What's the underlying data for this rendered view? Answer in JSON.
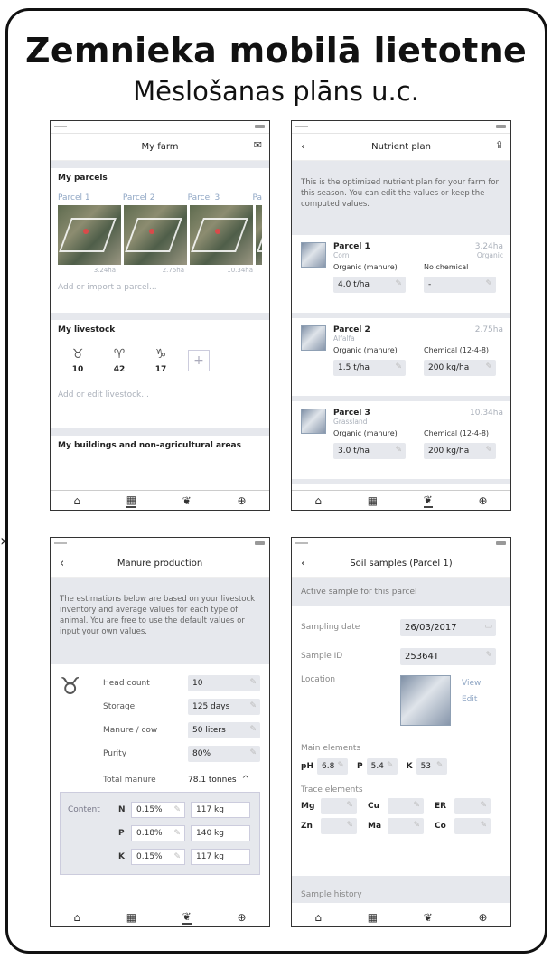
{
  "header": {
    "title": "Zemnieka mobilā lietotne",
    "subtitle": "Mēslošanas plāns u.c."
  },
  "farm": {
    "nav_title": "My farm",
    "parcels_heading": "My parcels",
    "parcel_labels": [
      "Parcel 1",
      "Parcel 2",
      "Parcel 3",
      "Pa"
    ],
    "parcel_areas": [
      "3.24ha",
      "2.75ha",
      "10.34ha"
    ],
    "add_parcel": "Add or import a parcel...",
    "livestock_heading": "My livestock",
    "livestock_counts": [
      "10",
      "42",
      "17"
    ],
    "add_livestock": "Add or edit livestock...",
    "buildings_heading": "My buildings and non-agricultural areas"
  },
  "nutrient": {
    "nav_title": "Nutrient plan",
    "intro": "This is the optimized nutrient plan for your farm for this season. You can edit the values or keep the computed values.",
    "parcels": [
      {
        "name": "Parcel 1",
        "area": "3.24ha",
        "crop": "Corn",
        "tag": "Organic",
        "left_label": "Organic (manure)",
        "right_label": "No chemical",
        "left_value": "4.0 t/ha",
        "right_value": "-"
      },
      {
        "name": "Parcel 2",
        "area": "2.75ha",
        "crop": "Alfalfa",
        "tag": "",
        "left_label": "Organic (manure)",
        "right_label": "Chemical (12-4-8)",
        "left_value": "1.5 t/ha",
        "right_value": "200 kg/ha"
      },
      {
        "name": "Parcel 3",
        "area": "10.34ha",
        "crop": "Grassland",
        "tag": "",
        "left_label": "Organic (manure)",
        "right_label": "Chemical (12-4-8)",
        "left_value": "3.0 t/ha",
        "right_value": "200 kg/ha"
      }
    ]
  },
  "manure": {
    "nav_title": "Manure production",
    "intro": "The estimations below are based on your livestock inventory and average values for each type of animal. You are free to use the default values or input your own values.",
    "rows": [
      {
        "label": "Head count",
        "value": "10"
      },
      {
        "label": "Storage",
        "value": "125 days"
      },
      {
        "label": "Manure / cow",
        "value": "50 liters"
      },
      {
        "label": "Purity",
        "value": "80%"
      }
    ],
    "total_label": "Total manure",
    "total_value": "78.1 tonnes",
    "content_label": "Content",
    "content": [
      {
        "el": "N",
        "pct": "0.15%",
        "kg": "117 kg"
      },
      {
        "el": "P",
        "pct": "0.18%",
        "kg": "140 kg"
      },
      {
        "el": "K",
        "pct": "0.15%",
        "kg": "117 kg"
      }
    ]
  },
  "soil": {
    "nav_title": "Soil samples (Parcel 1)",
    "active_heading": "Active sample for this parcel",
    "date_label": "Sampling date",
    "date_value": "26/03/2017",
    "id_label": "Sample ID",
    "id_value": "25364T",
    "location_label": "Location",
    "view": "View",
    "edit": "Edit",
    "main_heading": "Main elements",
    "main": [
      {
        "k": "pH",
        "v": "6.8"
      },
      {
        "k": "P",
        "v": "5.4"
      },
      {
        "k": "K",
        "v": "53"
      }
    ],
    "trace_heading": "Trace elements",
    "trace": [
      "Mg",
      "Cu",
      "ER",
      "Zn",
      "Ma",
      "Co"
    ],
    "history_heading": "Sample history"
  }
}
